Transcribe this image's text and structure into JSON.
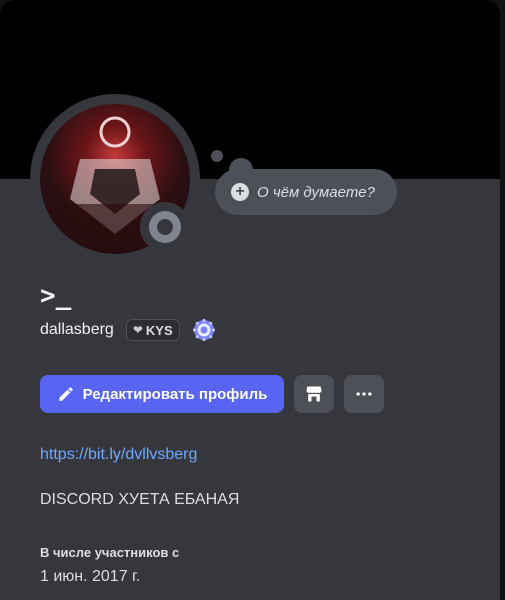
{
  "thought": {
    "placeholder": "О чём думаете?"
  },
  "profile": {
    "display_name": ">_",
    "username": "dallasberg",
    "clan_tag": "KYS",
    "status": "offline",
    "link": "https://bit.ly/dvllvsberg",
    "bio": "DISCORD ХУЕТА ЕБАНАЯ",
    "member_since_label": "В числе участников с",
    "member_since_date": "1 июн. 2017 г."
  },
  "buttons": {
    "edit_label": "Редактировать профиль",
    "shop_icon": "shop-icon",
    "more_icon": "more-dots-icon"
  },
  "colors": {
    "accent": "#5865f2",
    "link": "#6ea8ff",
    "card_bg": "#36373d",
    "banner": "#000000",
    "status_offline": "#80848e"
  }
}
